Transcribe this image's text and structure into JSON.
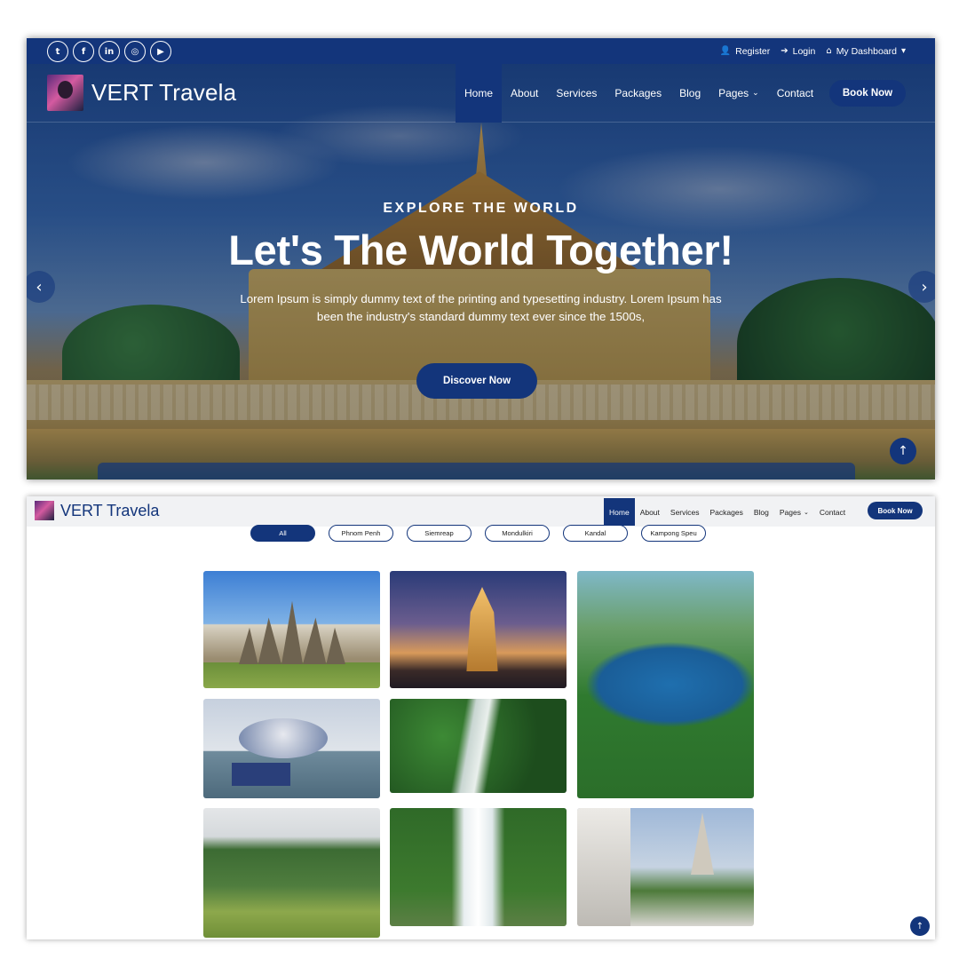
{
  "topbar": {
    "social": [
      {
        "icon": "twitter-icon",
        "glyph": "t"
      },
      {
        "icon": "facebook-icon",
        "glyph": "f"
      },
      {
        "icon": "linkedin-icon",
        "glyph": "in"
      },
      {
        "icon": "instagram-icon",
        "glyph": "◎"
      },
      {
        "icon": "youtube-icon",
        "glyph": "▶"
      }
    ],
    "register": "Register",
    "login": "Login",
    "dashboard": "My Dashboard"
  },
  "brand": {
    "name": "VERT Travela"
  },
  "nav": {
    "items": [
      "Home",
      "About",
      "Services",
      "Packages",
      "Blog",
      "Pages",
      "Contact"
    ],
    "active": "Home",
    "book_now": "Book Now"
  },
  "hero": {
    "eyebrow": "EXPLORE THE WORLD",
    "headline": "Let's The World Together!",
    "description": "Lorem Ipsum is simply dummy text of the printing and typesetting industry. Lorem Ipsum has been the industry's standard dummy text ever since the 1500s,",
    "cta": "Discover Now"
  },
  "gallery": {
    "filters": [
      "All",
      "Phnom Penh",
      "Siemreap",
      "Mondulkiri",
      "Kandal",
      "Kampong Speu"
    ],
    "active_filter": "All"
  },
  "colors": {
    "primary": "#13357b",
    "white": "#ffffff"
  },
  "icons": {
    "user": "user-icon",
    "login": "sign-in-icon",
    "home": "home-icon",
    "arrow_left": "chevron-left-icon",
    "arrow_right": "chevron-right-icon",
    "back_to_top": "arrow-up-icon"
  }
}
